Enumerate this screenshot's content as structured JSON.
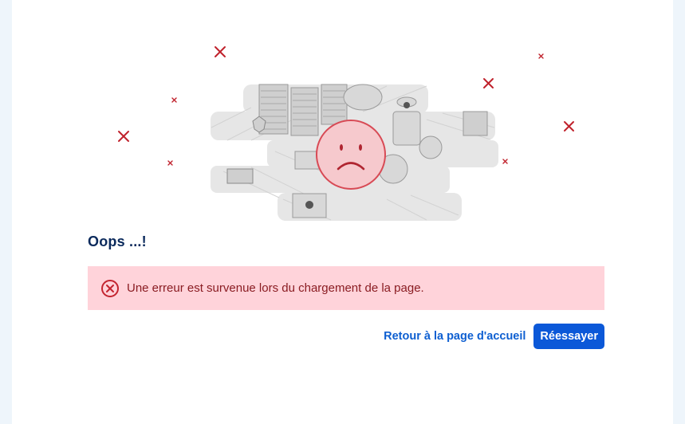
{
  "error_page": {
    "title": "Oops ...!",
    "message": "Une erreur est survenue lors du chargement de la page.",
    "home_link_label": "Retour à la page d'accueil",
    "retry_button_label": "Réessayer"
  },
  "icons": {
    "alert": "error-circle-x-icon",
    "illustration": "isometric-city-sad-face-illustration",
    "decor": "red-x-mark-icon"
  },
  "colors": {
    "title": "#0b2a5c",
    "alert_background": "#ffd3da",
    "alert_text": "#8a1c22",
    "alert_icon": "#c3242f",
    "x_marks": "#c0222c",
    "link": "#0e5fd1",
    "button_background": "#0b58d8",
    "button_text": "#ffffff",
    "sad_face_fill": "#f6c9cd",
    "sad_face_stroke": "#d84a55"
  }
}
